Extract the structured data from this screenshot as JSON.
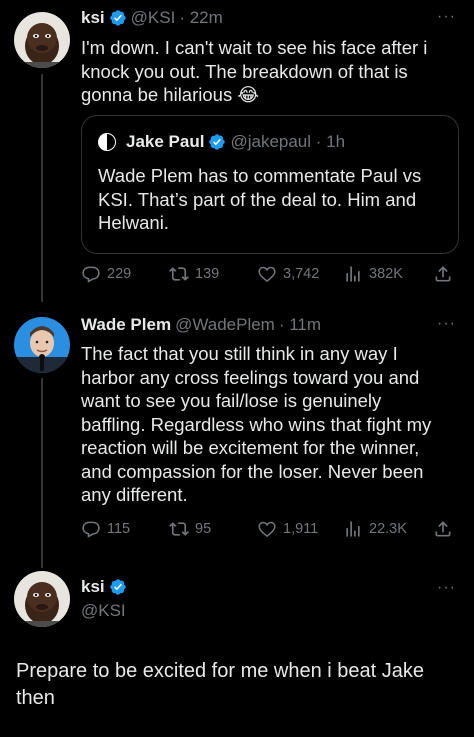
{
  "tweets": [
    {
      "name": "ksi",
      "handle": "@KSI",
      "time": "· 22m",
      "text": "I'm down. I can't wait to see his face after i\nknock you out. The breakdown of that is\ngonna be hilarious 😂",
      "quoted": {
        "name": "Jake Paul",
        "handle": "@jakepaul · 1h",
        "text": "Wade Plem has to commentate Paul vs\nKSI. That’s part of the deal to. Him and\nHelwani."
      },
      "stats": {
        "replies": "229",
        "retweets": "139",
        "likes": "3,742",
        "views": "382K"
      }
    },
    {
      "name": "Wade Plem",
      "handle": "@WadePlem",
      "time": "· 11m",
      "text": "The fact that you still think in any way I\nharbor any cross feelings toward you and\nwant to see you fail/lose is genuinely\nbaffling. Regardless who wins that fight my\nreaction will be excitement for the winner,\nand compassion for the loser. Never been\nany different.",
      "stats": {
        "replies": "115",
        "retweets": "95",
        "likes": "1,911",
        "views": "22.3K"
      }
    },
    {
      "name": "ksi",
      "handle": "@KSI",
      "text": "Prepare to be excited for me when i beat Jake\nthen"
    }
  ],
  "more_label": "···",
  "icons": [
    "reply-icon",
    "retweet-icon",
    "like-icon",
    "views-icon",
    "share-icon",
    "verified-icon",
    "more-icon"
  ],
  "colors": {
    "background": "#000000",
    "text": "#e7e9ea",
    "secondary": "#71767b",
    "verified": "#1d9bf0",
    "border": "#2f3336"
  }
}
